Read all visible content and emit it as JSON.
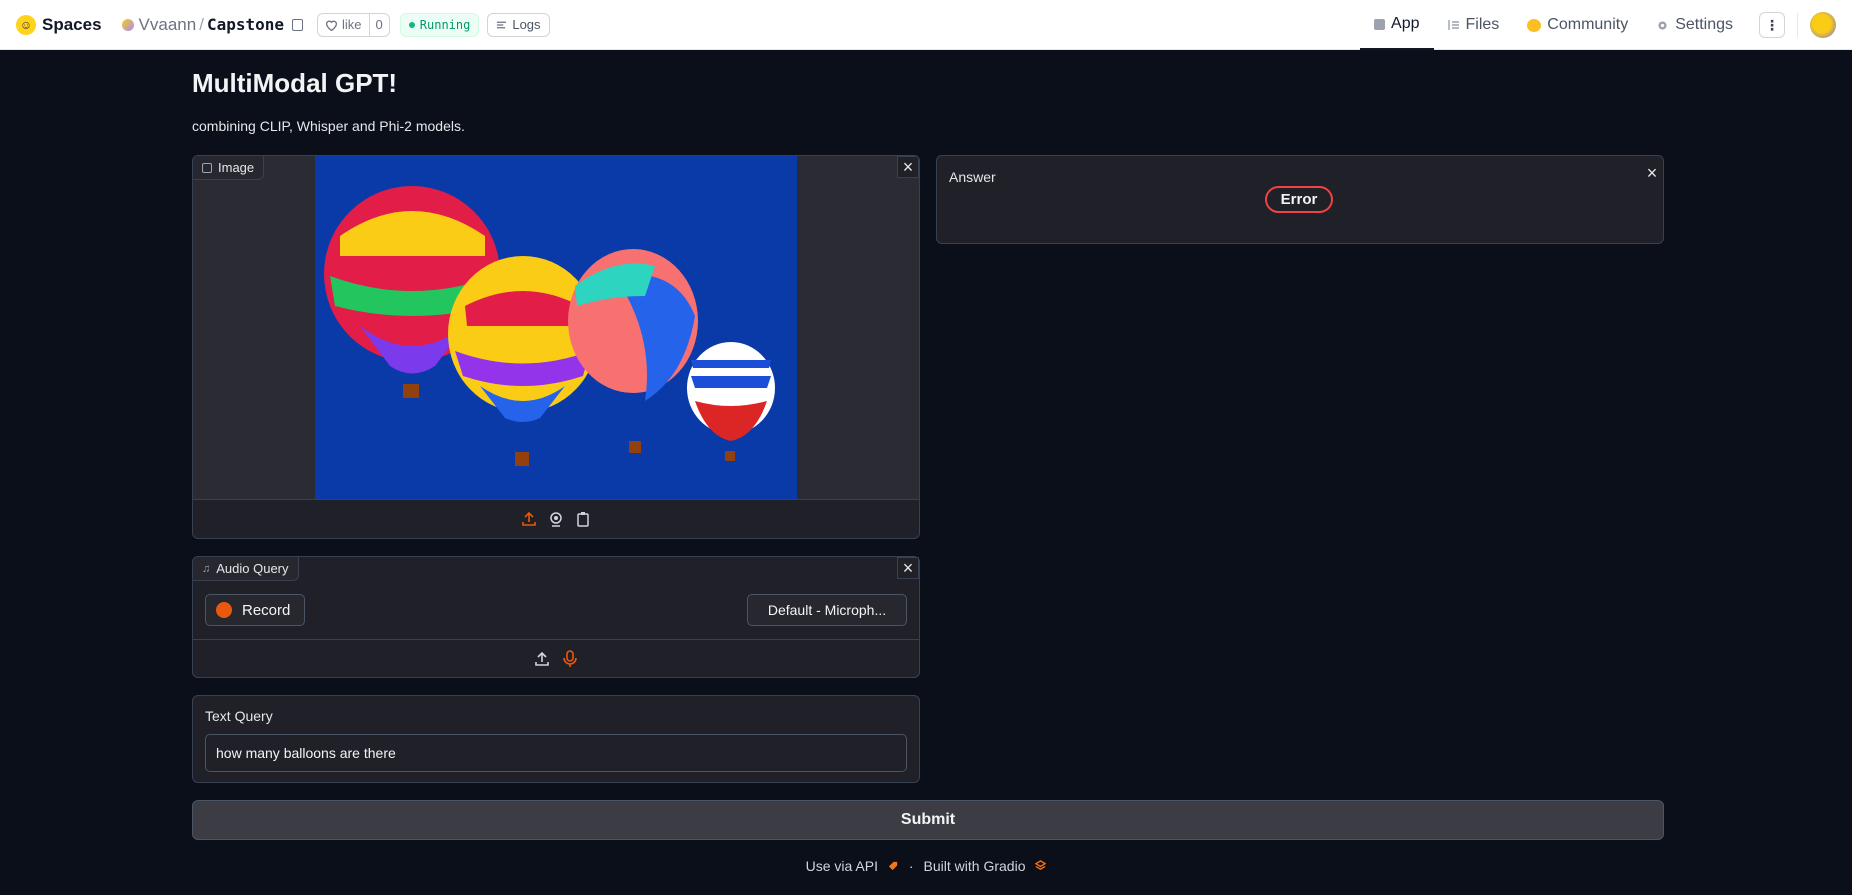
{
  "topbar": {
    "brand": "Spaces",
    "owner": "Vvaann",
    "repo": "Capstone",
    "like_label": "like",
    "like_count": "0",
    "status": "Running",
    "logs": "Logs",
    "nav": {
      "app": "App",
      "files": "Files",
      "community": "Community",
      "settings": "Settings"
    }
  },
  "main": {
    "title": "MultiModal GPT!",
    "description": "combining CLIP, Whisper and Phi-2 models.",
    "image_panel": {
      "label": "Image"
    },
    "audio_panel": {
      "label": "Audio Query",
      "record_label": "Record",
      "mic_selected": "Default - Microph..."
    },
    "text_panel": {
      "label": "Text Query",
      "value": "how many balloons are there"
    },
    "answer_panel": {
      "label": "Answer",
      "status": "Error"
    },
    "submit_label": "Submit"
  },
  "footer": {
    "api": "Use via API",
    "separator": "·",
    "built": "Built with Gradio"
  },
  "colors": {
    "background": "#0b0f19",
    "panel": "#1f2028",
    "accent": "#ea580c",
    "error": "#ef4444",
    "running": "#059669"
  }
}
